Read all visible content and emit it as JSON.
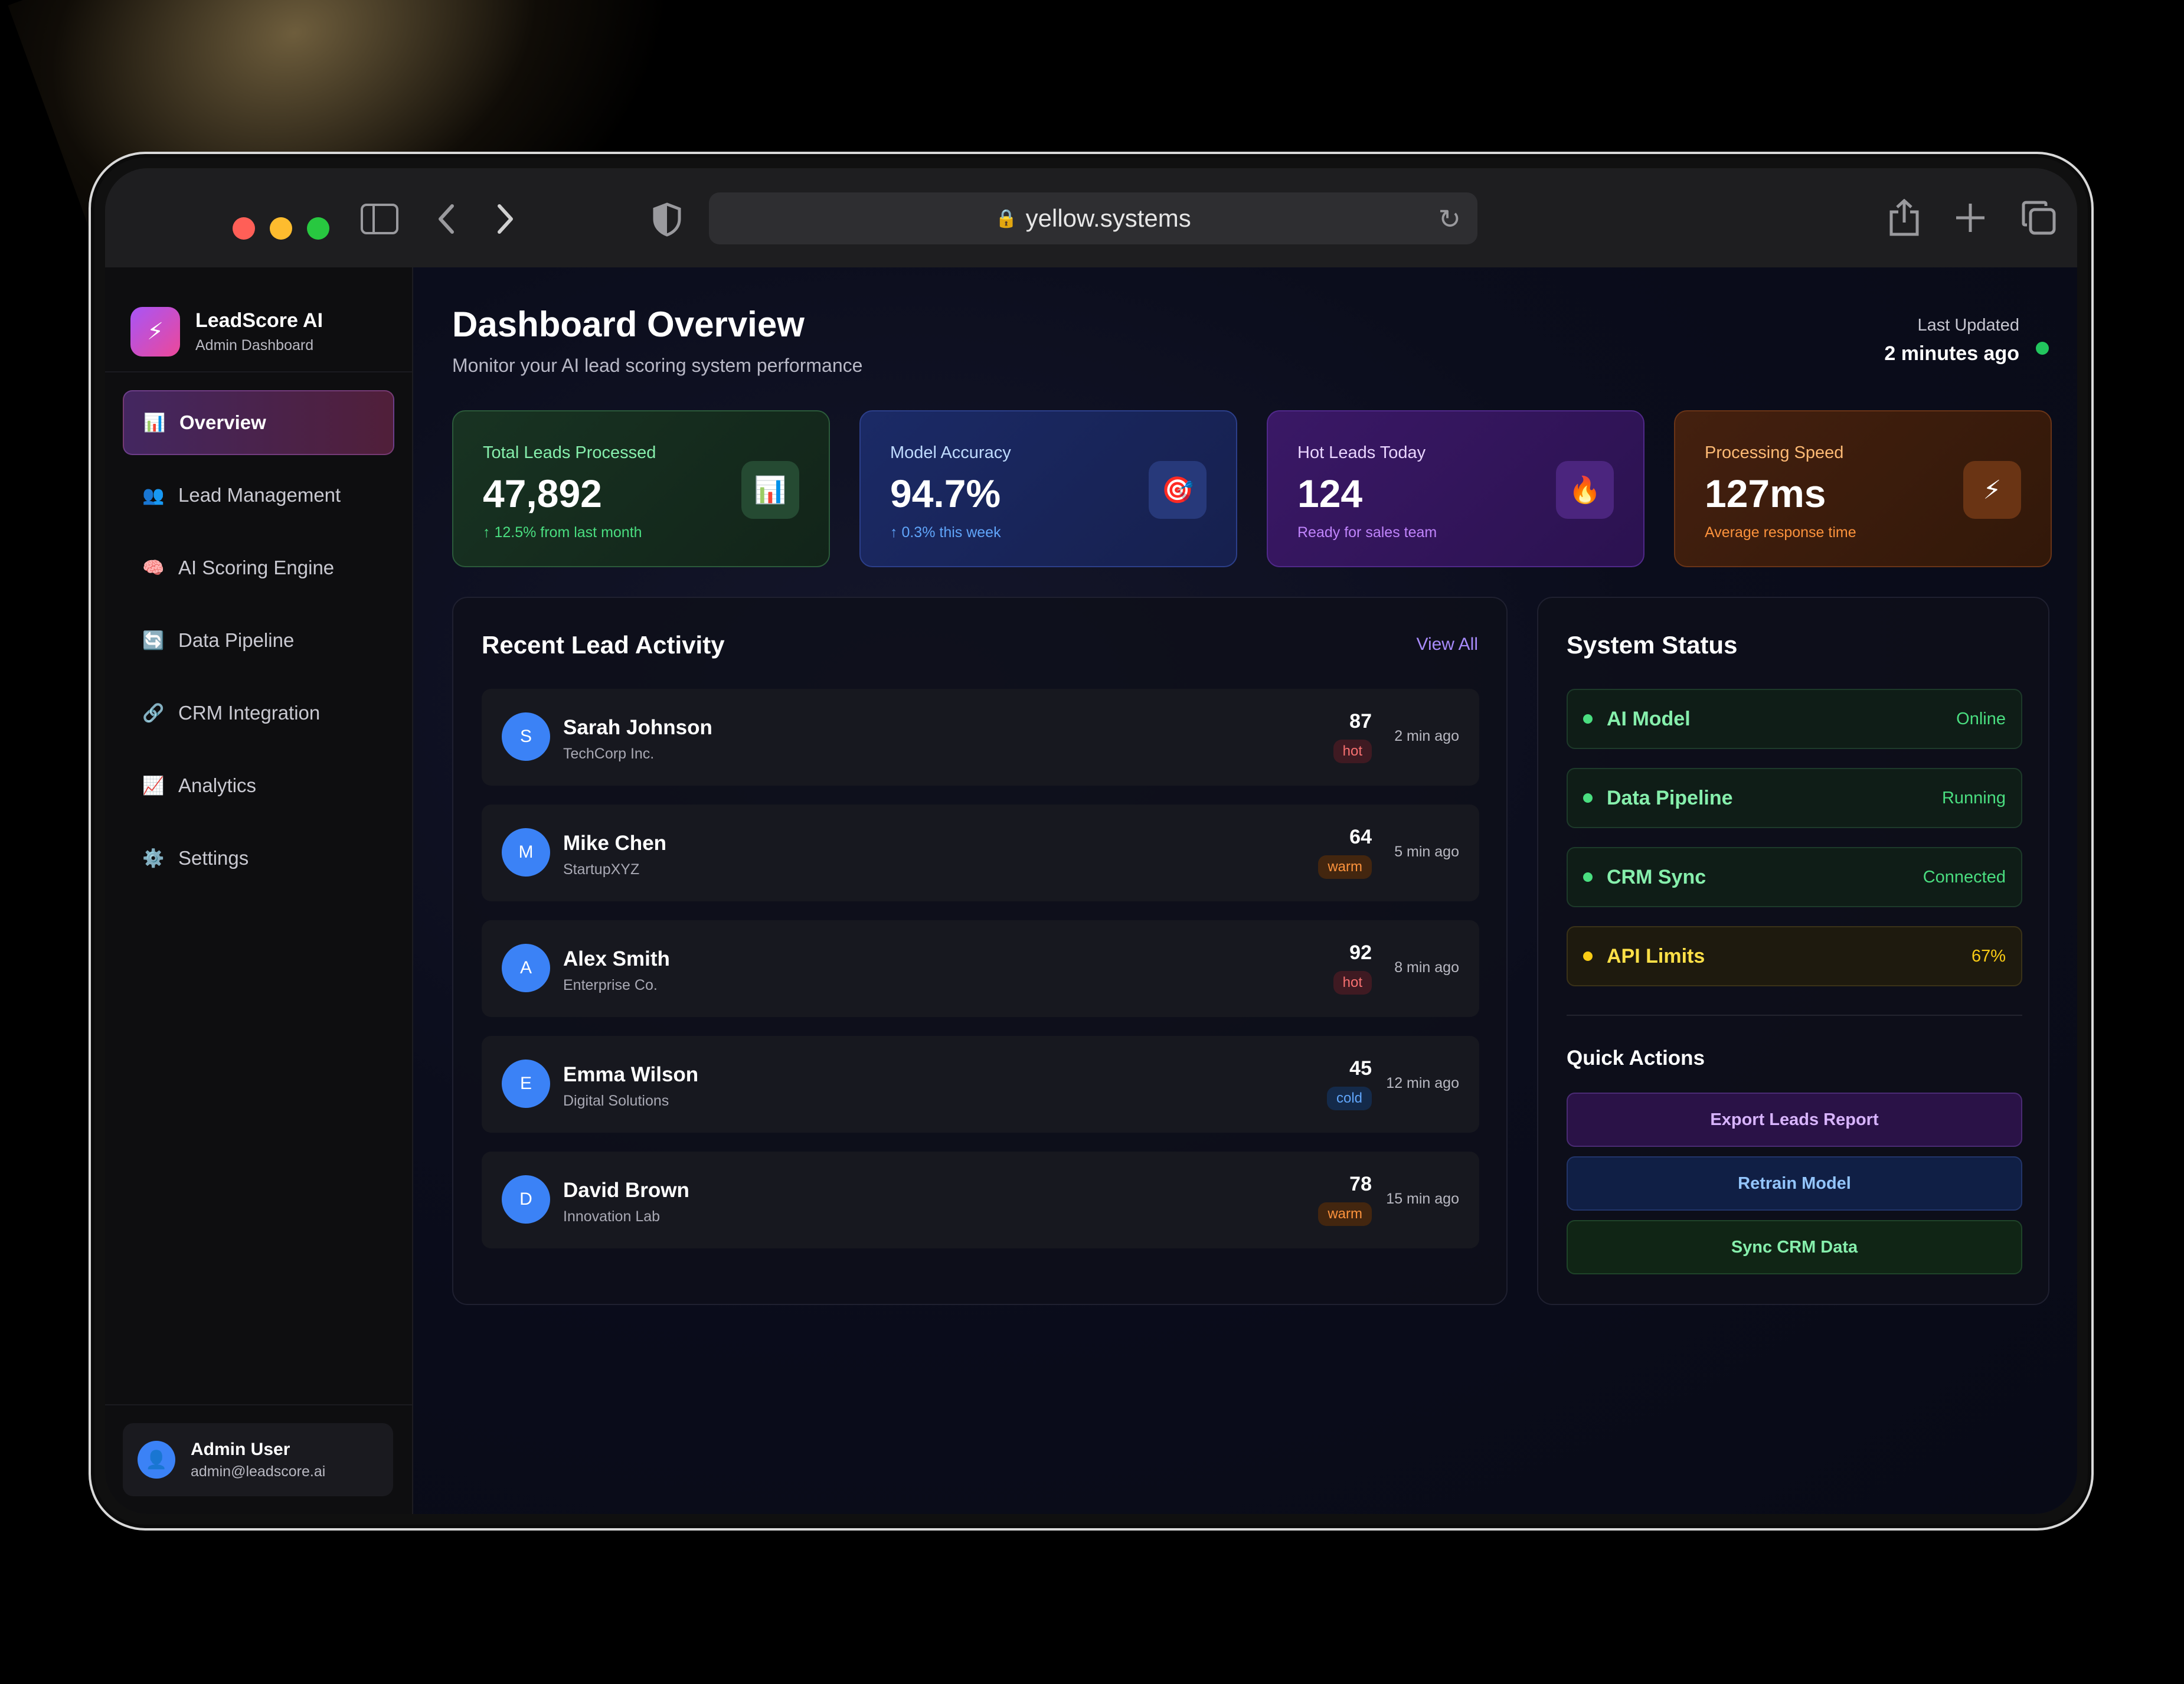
{
  "browser": {
    "url": "yellow.systems"
  },
  "brand": {
    "name": "LeadScore AI",
    "subtitle": "Admin Dashboard",
    "logo_icon": "lightning-icon"
  },
  "nav": {
    "items": [
      {
        "label": "Overview",
        "icon": "bar-chart-icon",
        "active": true
      },
      {
        "label": "Lead Management",
        "icon": "users-icon",
        "active": false
      },
      {
        "label": "AI Scoring Engine",
        "icon": "brain-icon",
        "active": false
      },
      {
        "label": "Data Pipeline",
        "icon": "refresh-icon",
        "active": false
      },
      {
        "label": "CRM Integration",
        "icon": "link-icon",
        "active": false
      },
      {
        "label": "Analytics",
        "icon": "trend-chart-icon",
        "active": false
      },
      {
        "label": "Settings",
        "icon": "gear-icon",
        "active": false
      }
    ]
  },
  "user": {
    "name": "Admin User",
    "email": "admin@leadscore.ai"
  },
  "header": {
    "title": "Dashboard Overview",
    "subtitle": "Monitor your AI lead scoring system performance",
    "last_updated_label": "Last Updated",
    "last_updated_value": "2 minutes ago"
  },
  "stats": [
    {
      "label": "Total Leads Processed",
      "value": "47,892",
      "note": "↑ 12.5% from last month",
      "icon": "bar-chart-icon",
      "accent": "#4ade80"
    },
    {
      "label": "Model Accuracy",
      "value": "94.7%",
      "note": "↑ 0.3% this week",
      "icon": "target-icon",
      "accent": "#60a5fa"
    },
    {
      "label": "Hot Leads Today",
      "value": "124",
      "note": "Ready for sales team",
      "icon": "fire-icon",
      "accent": "#c084fc"
    },
    {
      "label": "Processing Speed",
      "value": "127ms",
      "note": "Average response time",
      "icon": "lightning-icon",
      "accent": "#fb923c"
    }
  ],
  "recent_activity": {
    "title": "Recent Lead Activity",
    "view_all": "View All",
    "leads": [
      {
        "initial": "S",
        "name": "Sarah Johnson",
        "company": "TechCorp Inc.",
        "score": "87",
        "temp": "hot",
        "time": "2 min ago"
      },
      {
        "initial": "M",
        "name": "Mike Chen",
        "company": "StartupXYZ",
        "score": "64",
        "temp": "warm",
        "time": "5 min ago"
      },
      {
        "initial": "A",
        "name": "Alex Smith",
        "company": "Enterprise Co.",
        "score": "92",
        "temp": "hot",
        "time": "8 min ago"
      },
      {
        "initial": "E",
        "name": "Emma Wilson",
        "company": "Digital Solutions",
        "score": "45",
        "temp": "cold",
        "time": "12 min ago"
      },
      {
        "initial": "D",
        "name": "David Brown",
        "company": "Innovation Lab",
        "score": "78",
        "temp": "warm",
        "time": "15 min ago"
      }
    ]
  },
  "system_status": {
    "title": "System Status",
    "items": [
      {
        "name": "AI Model",
        "value": "Online",
        "color": "#4ade80"
      },
      {
        "name": "Data Pipeline",
        "value": "Running",
        "color": "#4ade80"
      },
      {
        "name": "CRM Sync",
        "value": "Connected",
        "color": "#4ade80"
      },
      {
        "name": "API Limits",
        "value": "67%",
        "color": "#facc15"
      }
    ],
    "quick_actions_title": "Quick Actions",
    "quick_actions": [
      {
        "label": "Export Leads Report"
      },
      {
        "label": "Retrain Model"
      },
      {
        "label": "Sync CRM Data"
      }
    ]
  }
}
